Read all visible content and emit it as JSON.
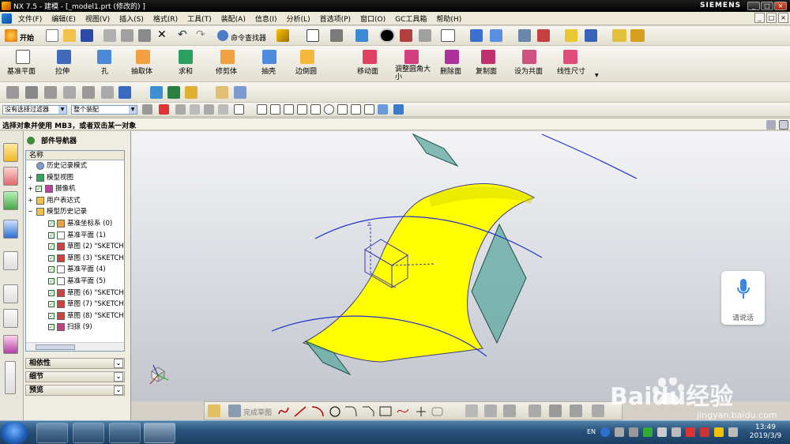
{
  "window": {
    "title": "NX 7.5 - 建模 - [_model1.prt (修改的) ]",
    "brand": "SIEMENS",
    "min_glyph": "_",
    "max_glyph": "□",
    "close_glyph": "×"
  },
  "menu": {
    "items": [
      "文件(F)",
      "编辑(E)",
      "视图(V)",
      "插入(S)",
      "格式(R)",
      "工具(T)",
      "装配(A)",
      "信息(I)",
      "分析(L)",
      "首选项(P)",
      "窗口(O)",
      "GC工具箱",
      "帮助(H)"
    ]
  },
  "standard_toolbar": {
    "start_label": "开始",
    "command_finder_label": "命令查找器"
  },
  "feature_toolbar": {
    "datum_plane": "基准平面",
    "extrude": "拉伸",
    "hole": "孔",
    "extract_body": "抽取体",
    "unite": "求和",
    "trim_body": "修剪体",
    "shell": "抽壳",
    "edge_blend": "边倒圆",
    "move_face": "移动面",
    "resize_blend": "调整圆角大小",
    "delete_face": "删除面",
    "copy_face": "复制面",
    "make_coplanar": "设为共面",
    "linear_dimension": "线性尺寸"
  },
  "selection_bar": {
    "filter_value": "没有选择过滤器",
    "scope_value": "整个装配"
  },
  "cue_line": "选择对象并使用 MB3，或者双击某一对象",
  "part_navigator": {
    "title": "部件导航器",
    "column_header": "名称",
    "rows": [
      {
        "label": "历史记录模式",
        "indent": 0,
        "check": false,
        "icon": "clock-icon"
      },
      {
        "label": "模型视图",
        "indent": 0,
        "check": false,
        "icon": "views-icon",
        "expand": "+"
      },
      {
        "label": "摄像机",
        "indent": 0,
        "check": true,
        "icon": "camera-icon",
        "expand": "+"
      },
      {
        "label": "用户表达式",
        "indent": 0,
        "check": false,
        "icon": "folder-icon",
        "expand": "+"
      },
      {
        "label": "模型历史记录",
        "indent": 0,
        "check": false,
        "icon": "folder-icon",
        "expand": "−"
      },
      {
        "label": "基准坐标系 (0)",
        "indent": 1,
        "check": true,
        "icon": "csys-icon"
      },
      {
        "label": "基准平面 (1)",
        "indent": 1,
        "check": true,
        "icon": "datum-plane-icon"
      },
      {
        "label": "草图 (2) \"SKETCH",
        "indent": 1,
        "check": true,
        "icon": "sketch-icon"
      },
      {
        "label": "草图 (3) \"SKETCH",
        "indent": 1,
        "check": true,
        "icon": "sketch-icon"
      },
      {
        "label": "基准平面 (4)",
        "indent": 1,
        "check": true,
        "icon": "datum-plane-icon"
      },
      {
        "label": "基准平面 (5)",
        "indent": 1,
        "check": true,
        "icon": "datum-plane-icon"
      },
      {
        "label": "草图 (6) \"SKETCH",
        "indent": 1,
        "check": true,
        "icon": "sketch-icon"
      },
      {
        "label": "草图 (7) \"SKETCH",
        "indent": 1,
        "check": true,
        "icon": "sketch-icon"
      },
      {
        "label": "草图 (8) \"SKETCH",
        "indent": 1,
        "check": true,
        "icon": "sketch-icon"
      },
      {
        "label": "扫掠 (9)",
        "indent": 1,
        "check": true,
        "icon": "sweep-icon"
      }
    ],
    "sections": [
      "相依性",
      "细节",
      "预览"
    ]
  },
  "bottom_toolbar": {
    "finish_sketch": "完成草图"
  },
  "voice_widget": {
    "label": "请说话"
  },
  "taskbar": {
    "lang": "EN",
    "time": "13:49",
    "date": "2019/3/9"
  },
  "watermark": {
    "logo": "Baidu经验",
    "url": "jingyan.baidu.com"
  },
  "colors": {
    "surface": "#ffff00",
    "datum_planes": "#5fa8a0",
    "curves": "#2233cc",
    "viewport_bg": "#dfe1e6"
  }
}
